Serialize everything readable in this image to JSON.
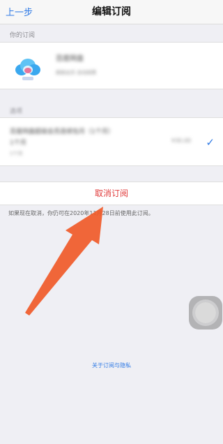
{
  "navbar": {
    "back_label": "上一步",
    "title": "编辑订阅"
  },
  "sections": {
    "your_subscription_header": "你的订阅",
    "options_header": "选项"
  },
  "subscription": {
    "app_name": "百度网盘",
    "app_detail": "超级会员 自动续费"
  },
  "plan": {
    "name_line1": "百度网盘超级会员连续包月（1个月）",
    "name_line2": "1个月",
    "duration": "1个月",
    "price": "¥30.00",
    "selected": true
  },
  "cancel": {
    "label": "取消订阅"
  },
  "footnote": "如果现在取消，你仍可在2020年11月28日前使用此订阅。",
  "privacy_link": "关于订阅与隐私",
  "colors": {
    "accent_blue": "#2f7ae5",
    "cancel_red": "#e03b3b",
    "annotation_arrow": "#f05a28",
    "background": "#efeff4"
  }
}
